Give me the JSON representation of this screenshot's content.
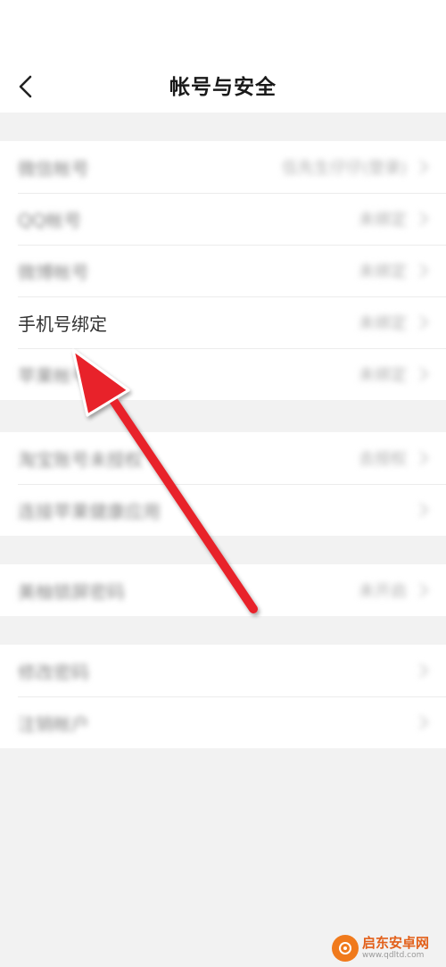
{
  "header": {
    "title": "帐号与安全"
  },
  "groups": [
    {
      "rows": [
        {
          "label": "微信帐号",
          "value": "伍先生仔仔(登录)",
          "focused": false
        },
        {
          "label": "QQ帐号",
          "value": "未绑定",
          "focused": false
        },
        {
          "label": "微博帐号",
          "value": "未绑定",
          "focused": false
        },
        {
          "label": "手机号绑定",
          "value": "未绑定",
          "focused": true
        },
        {
          "label": "苹果帐号",
          "value": "未绑定",
          "focused": false
        }
      ]
    },
    {
      "rows": [
        {
          "label": "淘宝账号未授权",
          "value": "去授权",
          "focused": false
        },
        {
          "label": "连接苹果健康应用",
          "value": "",
          "focused": false
        }
      ]
    },
    {
      "rows": [
        {
          "label": "美柚锁屏密码",
          "value": "未开启",
          "focused": false
        }
      ]
    },
    {
      "rows": [
        {
          "label": "修改密码",
          "value": "",
          "focused": false
        },
        {
          "label": "注销帐户",
          "value": "",
          "focused": false
        }
      ]
    }
  ],
  "annotation": {
    "arrow_color": "#e8232b"
  },
  "watermark": {
    "title": "启东安卓网",
    "url": "www.qdltd.com"
  },
  "colors": {
    "background": "#f2f2f2",
    "card": "#ffffff",
    "chevron": "#c4c4c4"
  }
}
